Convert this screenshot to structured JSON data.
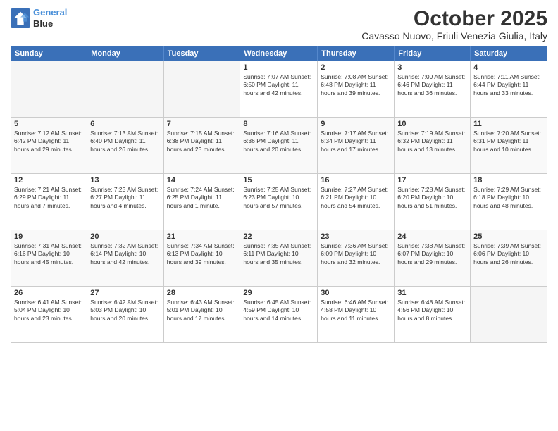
{
  "header": {
    "logo_line1": "General",
    "logo_line2": "Blue",
    "title": "October 2025",
    "subtitle": "Cavasso Nuovo, Friuli Venezia Giulia, Italy"
  },
  "days_of_week": [
    "Sunday",
    "Monday",
    "Tuesday",
    "Wednesday",
    "Thursday",
    "Friday",
    "Saturday"
  ],
  "weeks": [
    [
      {
        "day": "",
        "info": ""
      },
      {
        "day": "",
        "info": ""
      },
      {
        "day": "",
        "info": ""
      },
      {
        "day": "1",
        "info": "Sunrise: 7:07 AM\nSunset: 6:50 PM\nDaylight: 11 hours and 42 minutes."
      },
      {
        "day": "2",
        "info": "Sunrise: 7:08 AM\nSunset: 6:48 PM\nDaylight: 11 hours and 39 minutes."
      },
      {
        "day": "3",
        "info": "Sunrise: 7:09 AM\nSunset: 6:46 PM\nDaylight: 11 hours and 36 minutes."
      },
      {
        "day": "4",
        "info": "Sunrise: 7:11 AM\nSunset: 6:44 PM\nDaylight: 11 hours and 33 minutes."
      }
    ],
    [
      {
        "day": "5",
        "info": "Sunrise: 7:12 AM\nSunset: 6:42 PM\nDaylight: 11 hours and 29 minutes."
      },
      {
        "day": "6",
        "info": "Sunrise: 7:13 AM\nSunset: 6:40 PM\nDaylight: 11 hours and 26 minutes."
      },
      {
        "day": "7",
        "info": "Sunrise: 7:15 AM\nSunset: 6:38 PM\nDaylight: 11 hours and 23 minutes."
      },
      {
        "day": "8",
        "info": "Sunrise: 7:16 AM\nSunset: 6:36 PM\nDaylight: 11 hours and 20 minutes."
      },
      {
        "day": "9",
        "info": "Sunrise: 7:17 AM\nSunset: 6:34 PM\nDaylight: 11 hours and 17 minutes."
      },
      {
        "day": "10",
        "info": "Sunrise: 7:19 AM\nSunset: 6:32 PM\nDaylight: 11 hours and 13 minutes."
      },
      {
        "day": "11",
        "info": "Sunrise: 7:20 AM\nSunset: 6:31 PM\nDaylight: 11 hours and 10 minutes."
      }
    ],
    [
      {
        "day": "12",
        "info": "Sunrise: 7:21 AM\nSunset: 6:29 PM\nDaylight: 11 hours and 7 minutes."
      },
      {
        "day": "13",
        "info": "Sunrise: 7:23 AM\nSunset: 6:27 PM\nDaylight: 11 hours and 4 minutes."
      },
      {
        "day": "14",
        "info": "Sunrise: 7:24 AM\nSunset: 6:25 PM\nDaylight: 11 hours and 1 minute."
      },
      {
        "day": "15",
        "info": "Sunrise: 7:25 AM\nSunset: 6:23 PM\nDaylight: 10 hours and 57 minutes."
      },
      {
        "day": "16",
        "info": "Sunrise: 7:27 AM\nSunset: 6:21 PM\nDaylight: 10 hours and 54 minutes."
      },
      {
        "day": "17",
        "info": "Sunrise: 7:28 AM\nSunset: 6:20 PM\nDaylight: 10 hours and 51 minutes."
      },
      {
        "day": "18",
        "info": "Sunrise: 7:29 AM\nSunset: 6:18 PM\nDaylight: 10 hours and 48 minutes."
      }
    ],
    [
      {
        "day": "19",
        "info": "Sunrise: 7:31 AM\nSunset: 6:16 PM\nDaylight: 10 hours and 45 minutes."
      },
      {
        "day": "20",
        "info": "Sunrise: 7:32 AM\nSunset: 6:14 PM\nDaylight: 10 hours and 42 minutes."
      },
      {
        "day": "21",
        "info": "Sunrise: 7:34 AM\nSunset: 6:13 PM\nDaylight: 10 hours and 39 minutes."
      },
      {
        "day": "22",
        "info": "Sunrise: 7:35 AM\nSunset: 6:11 PM\nDaylight: 10 hours and 35 minutes."
      },
      {
        "day": "23",
        "info": "Sunrise: 7:36 AM\nSunset: 6:09 PM\nDaylight: 10 hours and 32 minutes."
      },
      {
        "day": "24",
        "info": "Sunrise: 7:38 AM\nSunset: 6:07 PM\nDaylight: 10 hours and 29 minutes."
      },
      {
        "day": "25",
        "info": "Sunrise: 7:39 AM\nSunset: 6:06 PM\nDaylight: 10 hours and 26 minutes."
      }
    ],
    [
      {
        "day": "26",
        "info": "Sunrise: 6:41 AM\nSunset: 5:04 PM\nDaylight: 10 hours and 23 minutes."
      },
      {
        "day": "27",
        "info": "Sunrise: 6:42 AM\nSunset: 5:03 PM\nDaylight: 10 hours and 20 minutes."
      },
      {
        "day": "28",
        "info": "Sunrise: 6:43 AM\nSunset: 5:01 PM\nDaylight: 10 hours and 17 minutes."
      },
      {
        "day": "29",
        "info": "Sunrise: 6:45 AM\nSunset: 4:59 PM\nDaylight: 10 hours and 14 minutes."
      },
      {
        "day": "30",
        "info": "Sunrise: 6:46 AM\nSunset: 4:58 PM\nDaylight: 10 hours and 11 minutes."
      },
      {
        "day": "31",
        "info": "Sunrise: 6:48 AM\nSunset: 4:56 PM\nDaylight: 10 hours and 8 minutes."
      },
      {
        "day": "",
        "info": ""
      }
    ]
  ]
}
